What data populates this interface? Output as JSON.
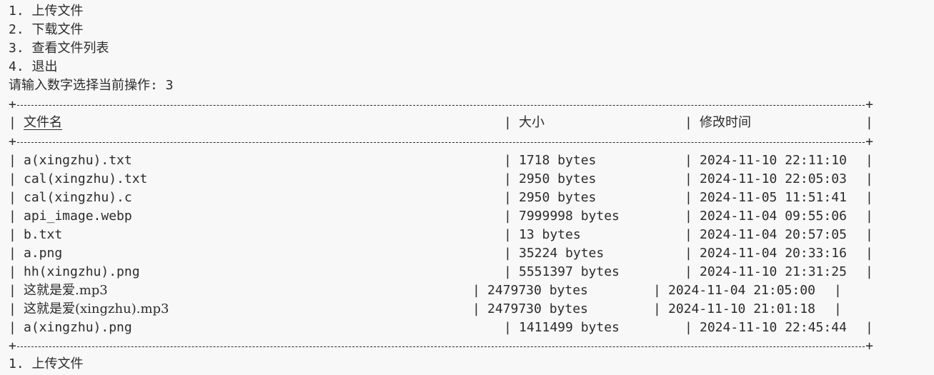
{
  "menu": {
    "items": [
      "1. 上传文件",
      "2. 下载文件",
      "3. 查看文件列表",
      "4. 退出"
    ],
    "prompt": "请输入数字选择当前操作: 3"
  },
  "table": {
    "headers": {
      "name": "文件名",
      "size": "大小",
      "mtime": "修改时间"
    },
    "rows": [
      {
        "name": "a(xingzhu).txt",
        "size": "1718 bytes",
        "mtime": "2024-11-10 22:11:10"
      },
      {
        "name": "cal(xingzhu).txt",
        "size": "2950 bytes",
        "mtime": "2024-11-10 22:05:03"
      },
      {
        "name": "cal(xingzhu).c",
        "size": "2950 bytes",
        "mtime": "2024-11-05 11:51:41"
      },
      {
        "name": "api_image.webp",
        "size": "7999998 bytes",
        "mtime": "2024-11-04 09:55:06"
      },
      {
        "name": "b.txt",
        "size": "13 bytes",
        "mtime": "2024-11-04 20:57:05"
      },
      {
        "name": "a.png",
        "size": "35224 bytes",
        "mtime": "2024-11-04 20:33:16"
      },
      {
        "name": "hh(xingzhu).png",
        "size": "5551397 bytes",
        "mtime": "2024-11-10 21:31:25"
      },
      {
        "name": "这就是爱.mp3",
        "size": "2479730 bytes",
        "mtime": "2024-11-04 21:05:00"
      },
      {
        "name": "这就是爱(xingzhu).mp3",
        "size": "2479730 bytes",
        "mtime": "2024-11-10 21:01:18"
      },
      {
        "name": "a(xingzhu).png",
        "size": "1411499 bytes",
        "mtime": "2024-11-10 22:45:44"
      }
    ]
  },
  "footer_menu_first": "1. 上传文件",
  "border_chars": {
    "plus": "+",
    "pipe": "|"
  }
}
